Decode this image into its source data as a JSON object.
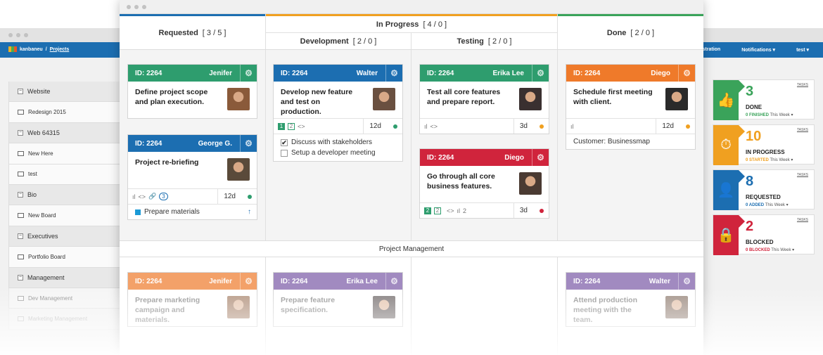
{
  "app": {
    "brand": "kanbaneu",
    "breadcrumb": "Projects",
    "nav_right": [
      "inistration",
      "Notifications",
      "test"
    ]
  },
  "sidebar": {
    "rows": [
      {
        "type": "group",
        "label": "Website",
        "toggle": "−"
      },
      {
        "type": "board",
        "label": "Redesign 2015"
      },
      {
        "type": "group",
        "label": "Web 64315",
        "toggle": "−"
      },
      {
        "type": "board",
        "label": "New Here"
      },
      {
        "type": "board",
        "label": "test"
      },
      {
        "type": "group",
        "label": "Bio",
        "toggle": "−"
      },
      {
        "type": "board",
        "label": "New Board"
      },
      {
        "type": "group",
        "label": "Executives",
        "toggle": "−"
      },
      {
        "type": "board",
        "label": "Portfolio Board"
      },
      {
        "type": "group",
        "label": "Management",
        "toggle": "−"
      },
      {
        "type": "board",
        "label": "Dev Management"
      },
      {
        "type": "board",
        "label": "Marketing Management"
      }
    ]
  },
  "board": {
    "columns": {
      "requested": {
        "label": "Requested",
        "count": "[ 3 / 5 ]"
      },
      "in_progress": {
        "label": "In Progress",
        "count": "[ 4 / 0 ]"
      },
      "development": {
        "label": "Development",
        "count": "[ 2 / 0 ]"
      },
      "testing": {
        "label": "Testing",
        "count": "[ 2 / 0 ]"
      },
      "done": {
        "label": "Done",
        "count": "[ 2 / 0 ]"
      }
    },
    "lane": "Project Management",
    "cards": [
      {
        "id": "ID: 2264",
        "owner": "Jenifer",
        "title": "Define project scope and plan execution.",
        "color": "#2e9d6e"
      },
      {
        "id": "ID: 2264",
        "owner": "George G.",
        "title": "Project re-briefing",
        "color": "#1c6eb1",
        "due": "12d",
        "badge": "3",
        "status_color": "#2e9d6e",
        "subtask": "Prepare materials",
        "subtask_arrow": "↑"
      },
      {
        "id": "ID: 2264",
        "owner": "Walter",
        "title": "Develop new feature and test on production.",
        "color": "#1c6eb1",
        "due": "12d",
        "status_color": "#2e9d6e",
        "steps": [
          "1",
          "2"
        ],
        "checklist": [
          {
            "label": "Discuss with stakeholders",
            "checked": true,
            "mark": "✔"
          },
          {
            "label": "Setup a developer meeting",
            "checked": false,
            "mark": ""
          }
        ]
      },
      {
        "id": "ID: 2264",
        "owner": "Erika Lee",
        "title": "Test all core features and prepare report.",
        "color": "#2e9d6e",
        "due": "3d",
        "status_color": "#f0a020"
      },
      {
        "id": "ID: 2264",
        "owner": "Diego",
        "title": "Go through all core business features.",
        "color": "#d0243c",
        "due": "3d",
        "status_color": "#d0243c",
        "steps": [
          "2",
          "2"
        ],
        "bar_count": "2"
      },
      {
        "id": "ID: 2264",
        "owner": "Diego",
        "title": "Schedule first meeting with client.",
        "color": "#ef7a2a",
        "due": "12d",
        "status_color": "#f0a020",
        "extra": "Customer: Businessmap"
      },
      {
        "id": "ID: 2264",
        "owner": "Jenifer",
        "title": "Prepare marketing campaign and materials.",
        "color": "#ef7a2a"
      },
      {
        "id": "ID: 2264",
        "owner": "Erika Lee",
        "title": "Prepare feature specification.",
        "color": "#7a5aa6"
      },
      {
        "id": "ID: 2264",
        "owner": "Walter",
        "title": "Attend production meeting with the team.",
        "color": "#7a5aa6"
      }
    ]
  },
  "stats": [
    {
      "num": "3",
      "label": "DONE",
      "sub_strong": "0 FINISHED",
      "sub": "This Week ▾",
      "tasks": "TASKS",
      "color": "#3aa35a",
      "icon": "👍"
    },
    {
      "num": "10",
      "label": "IN PROGRESS",
      "sub_strong": "0 STARTED",
      "sub": "This Week ▾",
      "tasks": "TASKS",
      "color": "#f0a020",
      "icon": "⏱"
    },
    {
      "num": "8",
      "label": "REQUESTED",
      "sub_strong": "0 ADDED",
      "sub": "This Week ▾",
      "tasks": "TASKS",
      "color": "#1c6eb1",
      "icon": "👤"
    },
    {
      "num": "2",
      "label": "BLOCKED",
      "sub_strong": "0 BLOCKED",
      "sub": "This Week ▾",
      "tasks": "TASKS",
      "color": "#d0243c",
      "icon": "🔒"
    }
  ],
  "icons": {
    "gear": "gear-icon",
    "bars": "bar-chart-icon",
    "code": "code-icon",
    "link": "link-icon"
  }
}
